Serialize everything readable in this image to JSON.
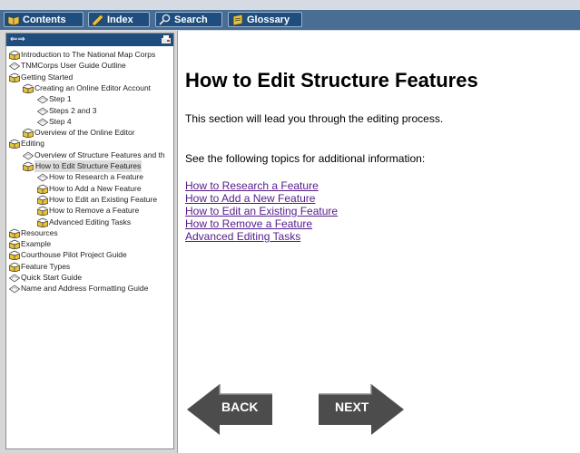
{
  "toolbar": {
    "tabs": [
      {
        "label": "Contents",
        "icon": "book-icon"
      },
      {
        "label": "Index",
        "icon": "pencil-icon"
      },
      {
        "label": "Search",
        "icon": "magnifier-icon"
      },
      {
        "label": "Glossary",
        "icon": "glossary-icon"
      }
    ]
  },
  "sidebar": {
    "toolbar_arrows": "⇐⇒",
    "tree": [
      {
        "label": "Introduction to The National Map Corps",
        "icon": "book-open-icon"
      },
      {
        "label": "TNMCorps User Guide Outline",
        "icon": "page-icon"
      },
      {
        "label": "Getting Started",
        "icon": "book-open-icon"
      },
      {
        "label": "Creating an Online Editor Account",
        "icon": "book-open-icon"
      },
      {
        "label": "Step 1",
        "icon": "page-icon"
      },
      {
        "label": "Steps 2 and 3",
        "icon": "page-icon"
      },
      {
        "label": "Step 4",
        "icon": "page-icon"
      },
      {
        "label": "Overview of the Online Editor",
        "icon": "book-open-icon"
      },
      {
        "label": "Editing",
        "icon": "book-open-icon"
      },
      {
        "label": "Overview of Structure Features and th",
        "icon": "page-icon"
      },
      {
        "label": "How to Edit Structure Features",
        "icon": "book-open-icon",
        "selected": true
      },
      {
        "label": "How to Research a Feature",
        "icon": "page-icon"
      },
      {
        "label": "How to Add a New Feature",
        "icon": "book-open-icon"
      },
      {
        "label": "How to Edit an Existing Feature",
        "icon": "book-open-icon"
      },
      {
        "label": "How to Remove a Feature",
        "icon": "book-open-icon"
      },
      {
        "label": "Advanced Editing Tasks",
        "icon": "book-open-icon"
      },
      {
        "label": "Resources",
        "icon": "book-open-icon"
      },
      {
        "label": "Example",
        "icon": "book-open-icon"
      },
      {
        "label": "Courthouse Pilot Project Guide",
        "icon": "book-open-icon"
      },
      {
        "label": "Feature Types",
        "icon": "book-open-icon"
      },
      {
        "label": "Quick Start Guide",
        "icon": "page-icon"
      },
      {
        "label": "Name and Address Formatting Guide",
        "icon": "page-icon"
      }
    ]
  },
  "main": {
    "title": "How to Edit Structure Features",
    "intro": "This section will lead you through the editing process.",
    "see_also": "See the following topics for additional information:",
    "links": [
      "How to Research a Feature",
      "How to Add a New Feature",
      "How to Edit an Existing Feature",
      "How to Remove a Feature",
      "Advanced Editing Tasks"
    ],
    "back_label": "BACK",
    "next_label": "NEXT"
  },
  "colors": {
    "toolbar_bg": "#4a6d93",
    "tab_bg": "#1f4e7e",
    "link_visited": "#551a8b",
    "book_yellow": "#e8c23a",
    "nav_arrow": "#4c4c4c"
  }
}
